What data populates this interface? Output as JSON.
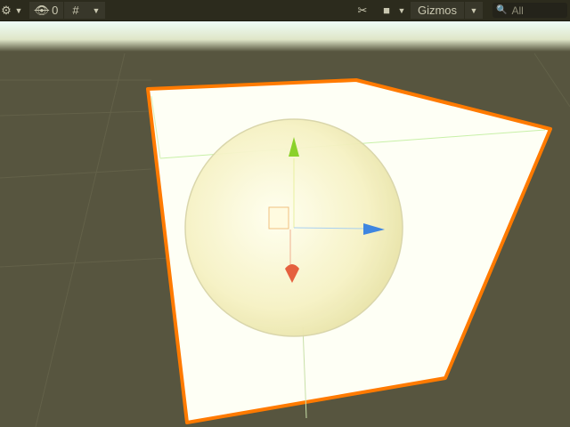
{
  "toolbar": {
    "hidden_count": "0",
    "gizmos_label": "Gizmos",
    "search_placeholder": "All",
    "icons": [
      "settings-icon",
      "visibility-off-icon",
      "grid-snap-icon",
      "tools-icon",
      "camera-icon",
      "search-icon"
    ]
  },
  "colors": {
    "toolbar_bg": "#2c2b1d",
    "scene_bg": "#57553f",
    "selection_outline": "#ff7a00",
    "axis_x": "#e5603f",
    "axis_y": "#8bd12a",
    "axis_z": "#3f86e0"
  }
}
